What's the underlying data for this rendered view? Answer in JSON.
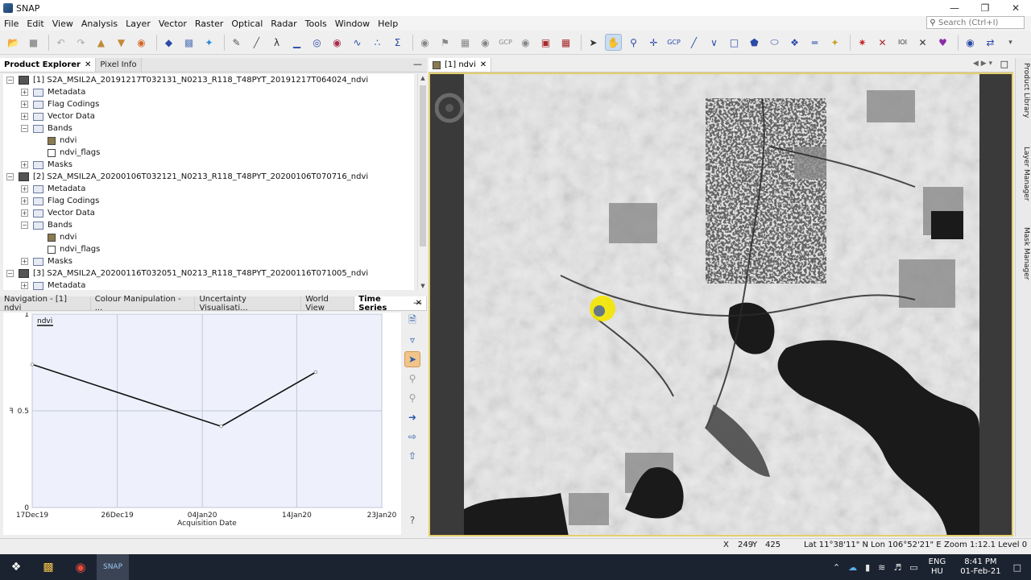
{
  "window": {
    "title": "SNAP",
    "controls": [
      "—",
      "❐",
      "✕"
    ]
  },
  "menu": [
    "File",
    "Edit",
    "View",
    "Analysis",
    "Layer",
    "Vector",
    "Raster",
    "Optical",
    "Radar",
    "Tools",
    "Window",
    "Help"
  ],
  "search": {
    "placeholder": "Search (Ctrl+I)"
  },
  "explorer": {
    "tabs": [
      "Product Explorer",
      "Pixel Info"
    ],
    "rows": [
      {
        "level": 0,
        "kind": "product",
        "toggle": "−",
        "label": "[1] S2A_MSIL2A_20191217T032131_N0213_R118_T48PYT_20191217T064024_ndvi"
      },
      {
        "level": 1,
        "kind": "folder",
        "toggle": "+",
        "label": "Metadata"
      },
      {
        "level": 1,
        "kind": "folder",
        "toggle": "+",
        "label": "Flag Codings"
      },
      {
        "level": 1,
        "kind": "folder",
        "toggle": "+",
        "label": "Vector Data"
      },
      {
        "level": 1,
        "kind": "folder",
        "toggle": "−",
        "label": "Bands"
      },
      {
        "level": 2,
        "kind": "band",
        "toggle": "",
        "label": "ndvi"
      },
      {
        "level": 2,
        "kind": "flag",
        "toggle": "",
        "label": "ndvi_flags"
      },
      {
        "level": 1,
        "kind": "folder",
        "toggle": "+",
        "label": "Masks"
      },
      {
        "level": 0,
        "kind": "product",
        "toggle": "−",
        "label": "[2] S2A_MSIL2A_20200106T032121_N0213_R118_T48PYT_20200106T070716_ndvi"
      },
      {
        "level": 1,
        "kind": "folder",
        "toggle": "+",
        "label": "Metadata"
      },
      {
        "level": 1,
        "kind": "folder",
        "toggle": "+",
        "label": "Flag Codings"
      },
      {
        "level": 1,
        "kind": "folder",
        "toggle": "+",
        "label": "Vector Data"
      },
      {
        "level": 1,
        "kind": "folder",
        "toggle": "−",
        "label": "Bands"
      },
      {
        "level": 2,
        "kind": "band",
        "toggle": "",
        "label": "ndvi"
      },
      {
        "level": 2,
        "kind": "flag",
        "toggle": "",
        "label": "ndvi_flags"
      },
      {
        "level": 1,
        "kind": "folder",
        "toggle": "+",
        "label": "Masks"
      },
      {
        "level": 0,
        "kind": "product",
        "toggle": "−",
        "label": "[3] S2A_MSIL2A_20200116T032051_N0213_R118_T48PYT_20200116T071005_ndvi"
      },
      {
        "level": 1,
        "kind": "folder",
        "toggle": "+",
        "label": "Metadata"
      }
    ]
  },
  "tools_panel": {
    "tabs": [
      "Navigation - [1] ndvi",
      "Colour Manipulation - ...",
      "Uncertainty Visualisati...",
      "World View",
      "Time Series"
    ],
    "selected_tab": "Time Series"
  },
  "chart_data": {
    "type": "line",
    "series": [
      {
        "name": "ndvi",
        "x": [
          "2019-12-17",
          "2020-01-06",
          "2020-01-16"
        ],
        "y": [
          0.74,
          0.42,
          0.7
        ]
      }
    ],
    "x_ticks": [
      "17Dec19",
      "26Dec19",
      "04Jan20",
      "14Jan20",
      "23Jan20"
    ],
    "x_range": [
      "2019-12-17",
      "2020-01-23"
    ],
    "y_ticks": [
      "0",
      "0.5",
      "1"
    ],
    "ylim": [
      0,
      1
    ],
    "xlabel": "Acquisition Date",
    "ylabel": "ꟻ",
    "legend": "top-left",
    "grid": true,
    "colors": {
      "line": "#111111",
      "plot_bg": "#eef0fb",
      "grid": "#c3c7d8"
    }
  },
  "image_view": {
    "tab_label": "[1] ndvi"
  },
  "right_strip": [
    "Product Library",
    "Layer Manager",
    "Mask Manager"
  ],
  "status": {
    "x_label": "X",
    "x": "249",
    "y_label": "Y",
    "y": "425",
    "latlon": "Lat 11°38'11\" N  Lon 106°52'21\" E",
    "zoom": "Zoom 1:12.1  Level 0"
  },
  "taskbar": {
    "lang1": "ENG",
    "lang2": "HU",
    "time": "8:41 PM",
    "date": "01-Feb-21"
  }
}
